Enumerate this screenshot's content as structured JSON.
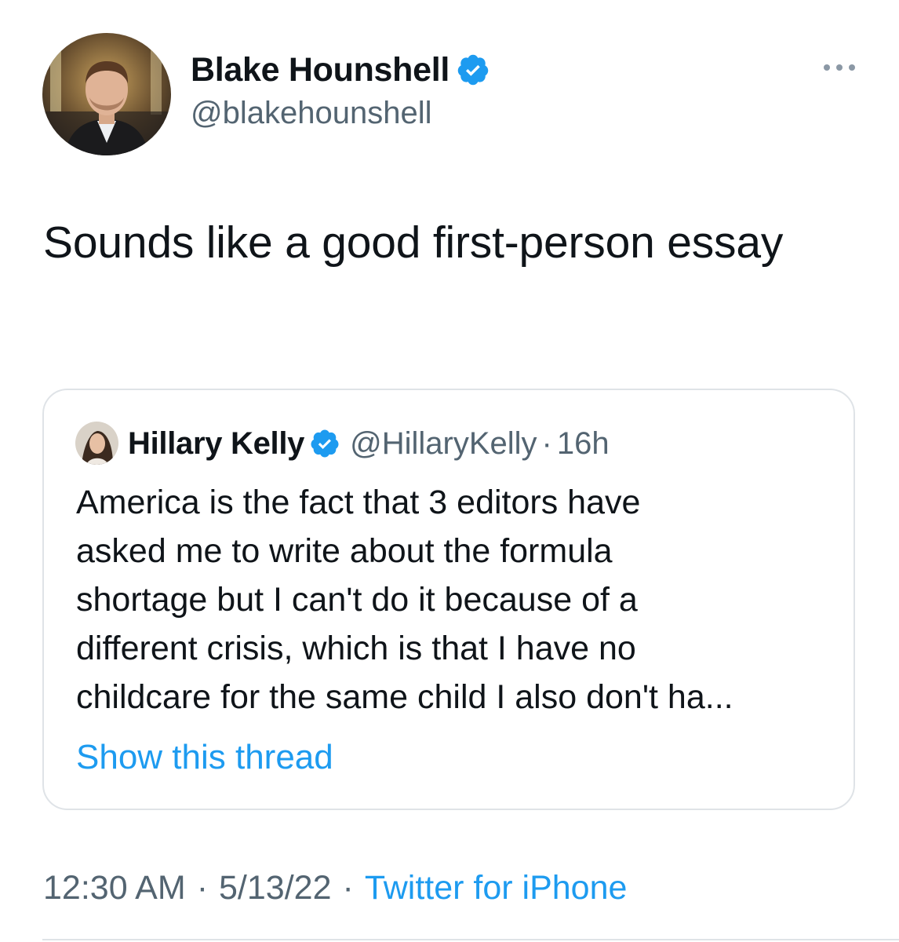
{
  "author": {
    "name": "Blake Hounshell",
    "handle": "@blakehounshell",
    "verified": true,
    "avatar_icon": "profile-photo"
  },
  "tweet": {
    "text": "Sounds like a good first-person essay"
  },
  "quoted_tweet": {
    "name": "Hillary Kelly",
    "handle": "@HillaryKelly",
    "separator": "·",
    "time": "16h",
    "verified": true,
    "text_lines": [
      "America is the fact that 3 editors have",
      "asked me to write about the formula",
      "shortage but I can't do it because of a",
      "different crisis, which is that I have no",
      "childcare for the same child I also don't ha..."
    ],
    "show_thread": "Show this thread"
  },
  "meta": {
    "time": "12:30 AM",
    "separator": "·",
    "date": "5/13/22",
    "source": "Twitter for iPhone"
  },
  "colors": {
    "accent": "#1d9bf0",
    "secondary_text": "#536471",
    "border": "#dfe3e7"
  }
}
